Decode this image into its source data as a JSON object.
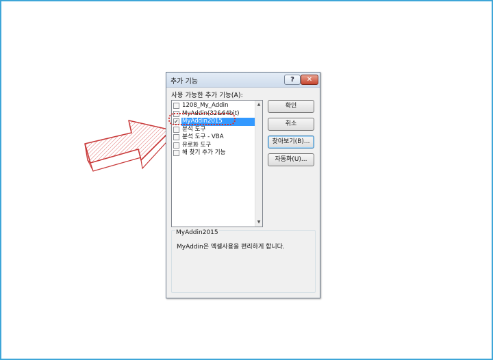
{
  "dialog": {
    "title": "추가 기능",
    "help_label": "?",
    "close_label": "✕",
    "list_label": "사용 가능한 추가 기능(A):",
    "items": [
      {
        "label": "1208_My_Addin",
        "checked": false,
        "selected": false
      },
      {
        "label": "MyAddin(32&64bit)",
        "checked": false,
        "selected": false
      },
      {
        "label": "MyAddin2015",
        "checked": true,
        "selected": true
      },
      {
        "label": "분석 도구",
        "checked": false,
        "selected": false
      },
      {
        "label": "분석 도구 - VBA",
        "checked": false,
        "selected": false
      },
      {
        "label": "유로화 도구",
        "checked": false,
        "selected": false
      },
      {
        "label": "해 찾기 추가 기능",
        "checked": false,
        "selected": false
      }
    ],
    "check_mark": "✓",
    "buttons": {
      "ok": "확인",
      "cancel": "취소",
      "browse": "찾아보기(B)...",
      "automation": "자동화(U)..."
    },
    "description": {
      "title": "MyAddin2015",
      "text": "MyAddin은 엑셀사용을 편리하게 합니다."
    }
  },
  "colors": {
    "selection": "#3399ff",
    "callout": "#d43030",
    "frame": "#3ea6d8"
  }
}
